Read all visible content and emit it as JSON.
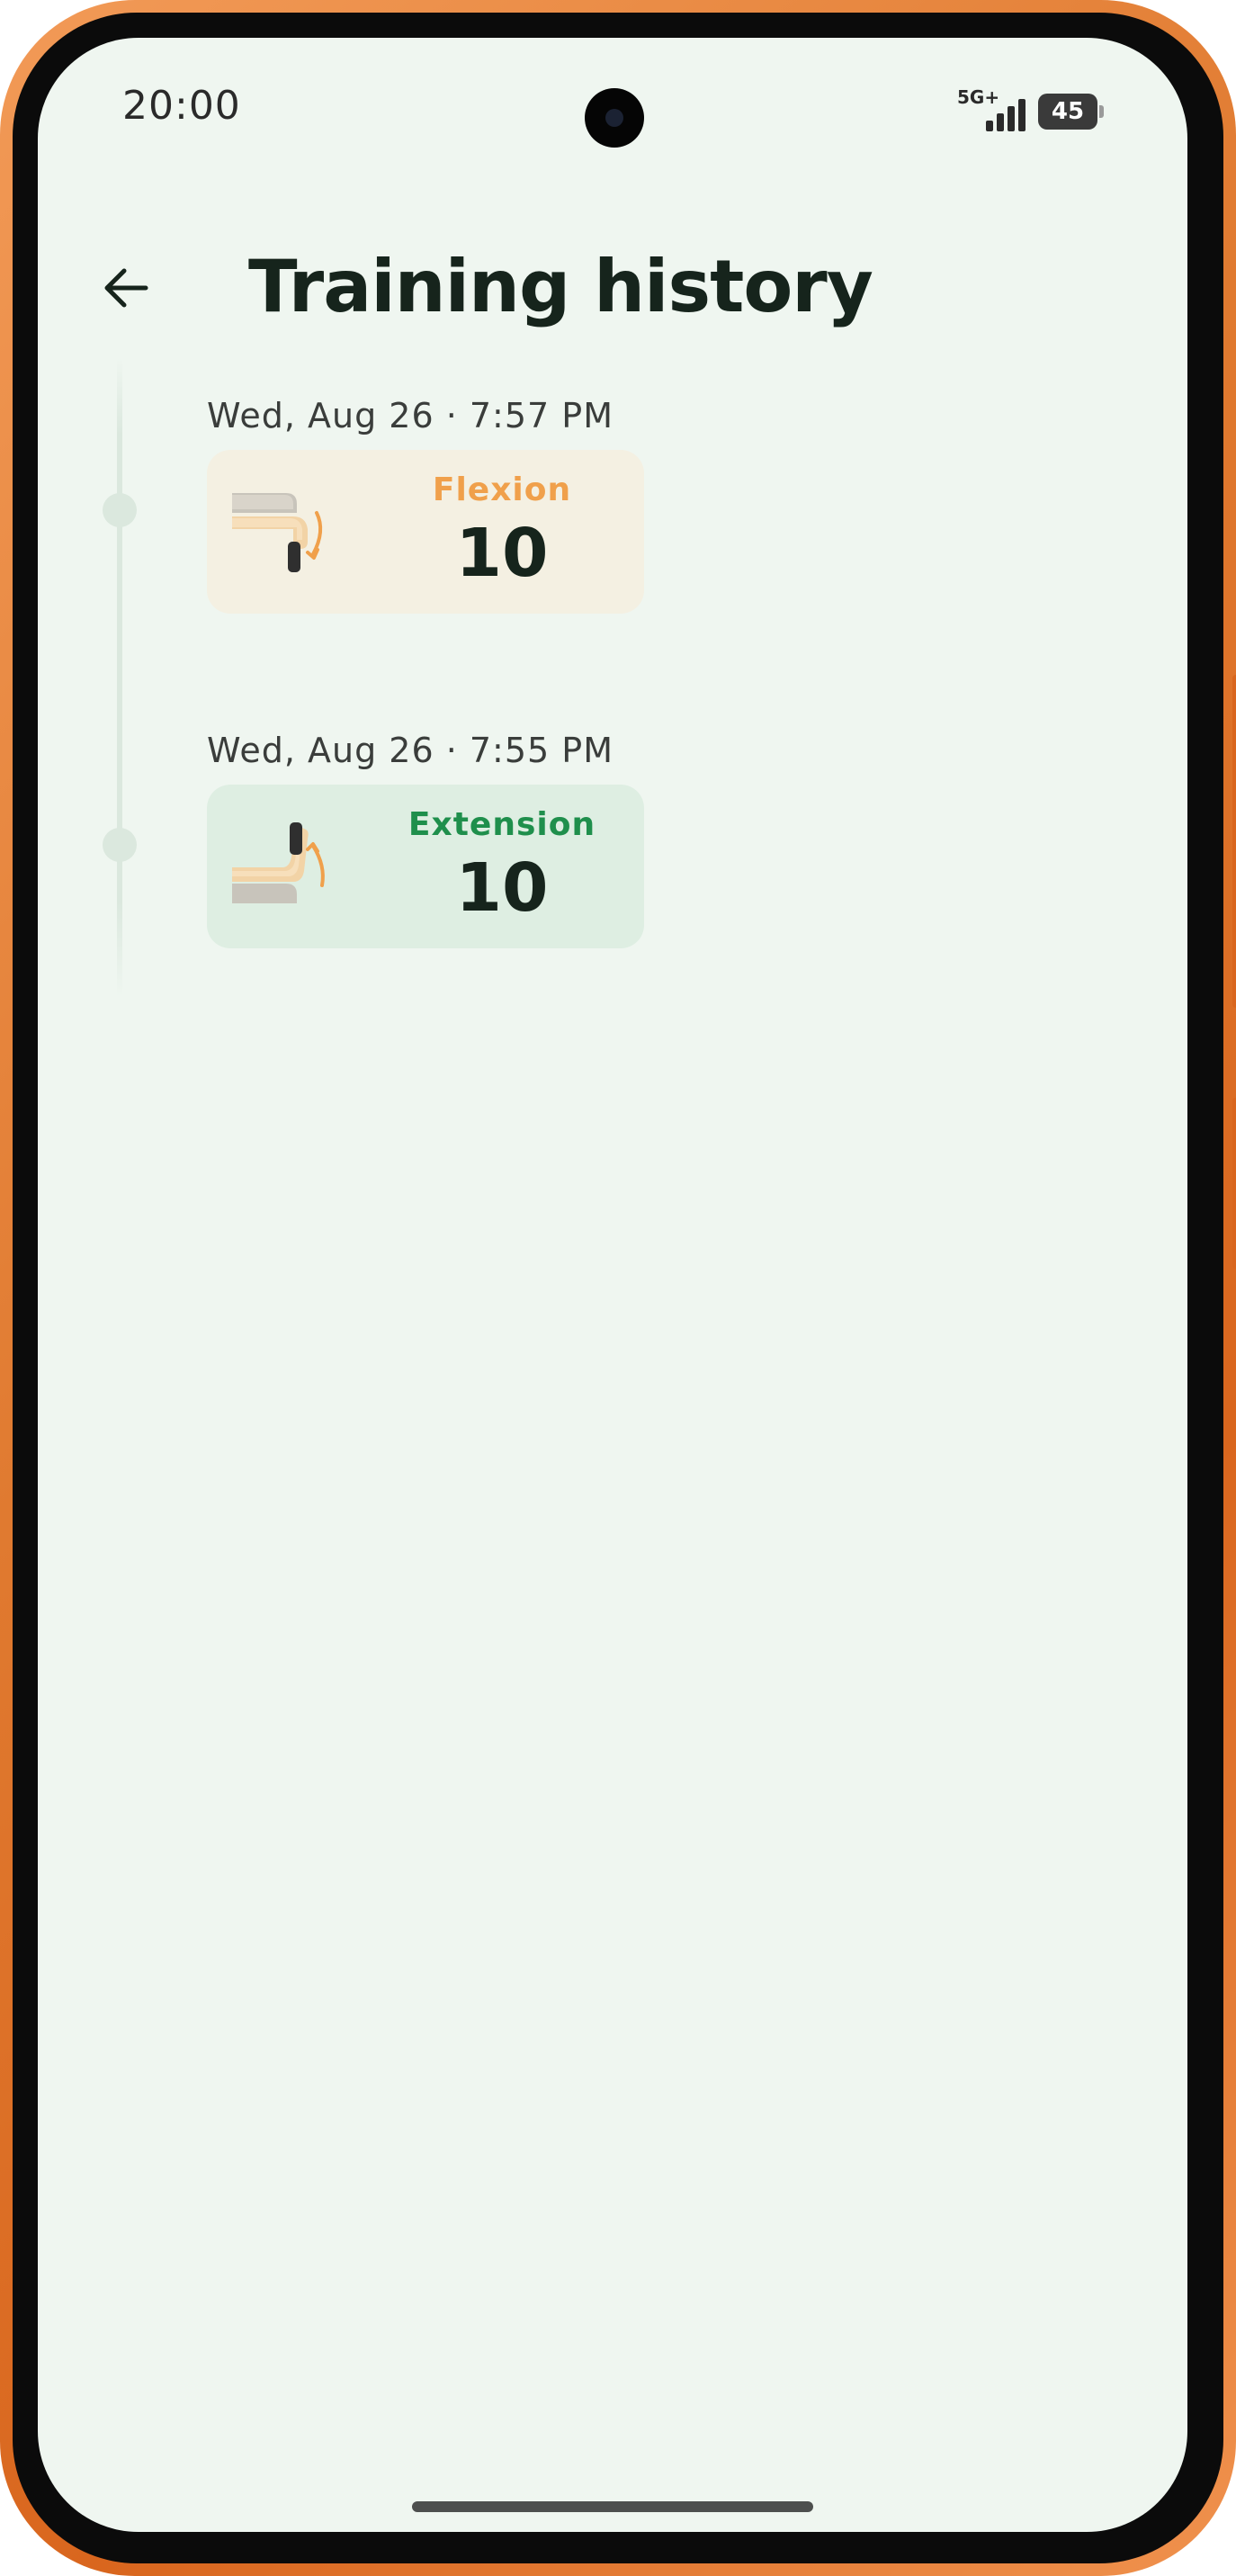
{
  "status_bar": {
    "time": "20:00",
    "network": "5G+",
    "battery": "45"
  },
  "header": {
    "title": "Training history"
  },
  "entries": [
    {
      "date": "Wed, Aug 26 · 7:57 PM",
      "type": "Flexion",
      "count": "10",
      "type_color": "#f0a04b"
    },
    {
      "date": "Wed, Aug 26 · 7:55 PM",
      "type": "Extension",
      "count": "10",
      "type_color": "#1f8f4c"
    }
  ],
  "colors": {
    "background": "#eff6f0",
    "frame": "#e07a30",
    "flexion_card": "#f4f0e2",
    "extension_card": "#deeee2"
  }
}
